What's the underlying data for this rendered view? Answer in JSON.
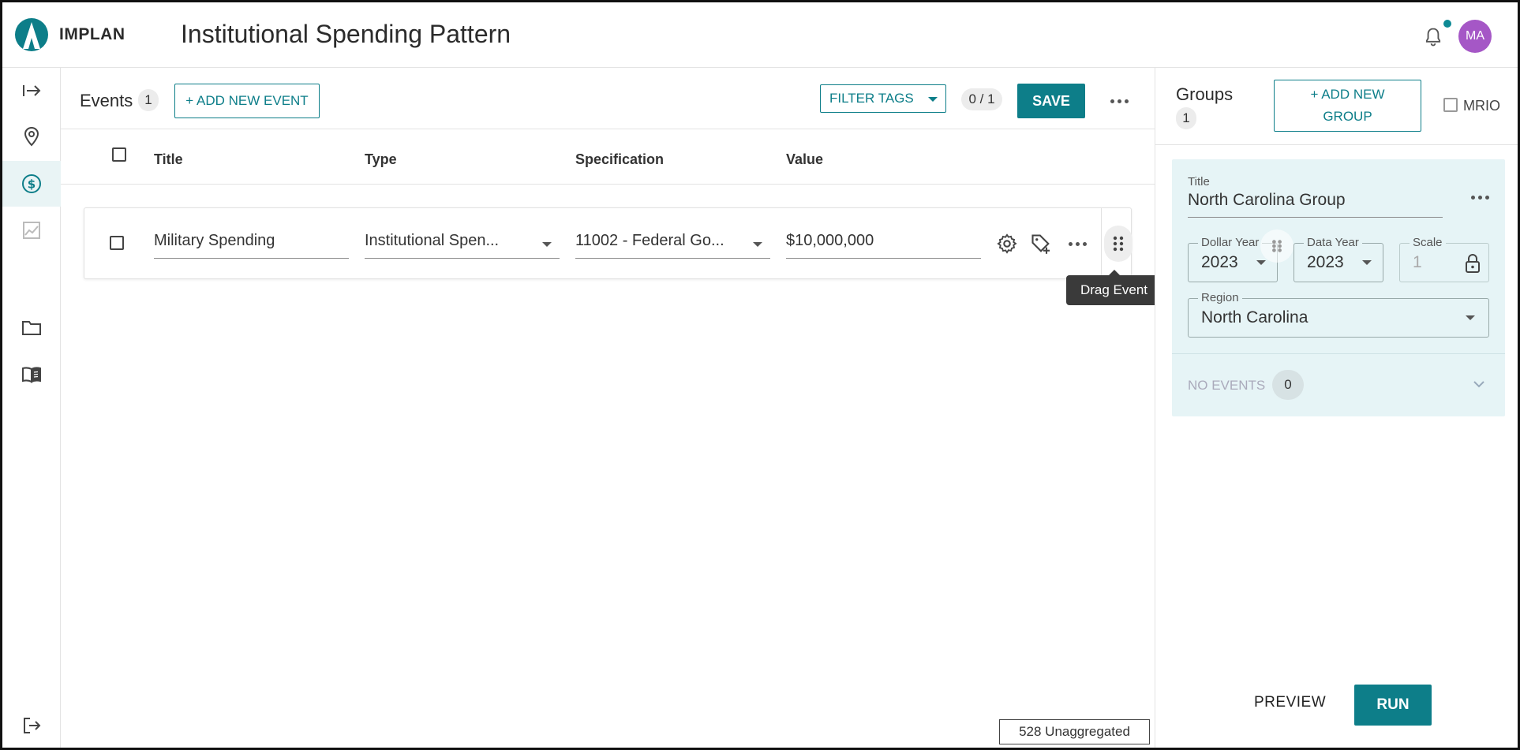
{
  "header": {
    "brand": "IMPLAN",
    "title": "Institutional Spending Pattern",
    "avatar_initials": "MA",
    "notification_dot_color": "#0d8a95",
    "avatar_color": "#a557c6"
  },
  "sidebar": {
    "items": [
      {
        "icon": "expand-arrow-icon"
      },
      {
        "icon": "location-pin-icon"
      },
      {
        "icon": "dollar-circle-icon",
        "active": true
      },
      {
        "icon": "chart-icon"
      },
      {
        "icon": "folder-icon"
      },
      {
        "icon": "book-icon"
      },
      {
        "icon": "logout-icon"
      }
    ]
  },
  "events": {
    "label": "Events",
    "count": "1",
    "add_button": "+ ADD NEW EVENT",
    "filter_tags": "FILTER TAGS",
    "selection_count": "0 / 1",
    "save_label": "SAVE",
    "columns": {
      "title": "Title",
      "type": "Type",
      "specification": "Specification",
      "value": "Value"
    },
    "rows": [
      {
        "title": "Military Spending",
        "type": "Institutional Spen...",
        "specification": "11002 - Federal Go...",
        "value": "$10,000,000"
      }
    ],
    "drag_tooltip": "Drag Event",
    "unaggregated_label": "528 Unaggregated"
  },
  "groups": {
    "label": "Groups",
    "count": "1",
    "add_button": "+ ADD NEW GROUP",
    "mrio_label": "MRIO",
    "card": {
      "title_label": "Title",
      "title_value": "North Carolina Group",
      "dollar_year_label": "Dollar Year",
      "dollar_year_value": "2023",
      "data_year_label": "Data Year",
      "data_year_value": "2023",
      "scale_label": "Scale",
      "scale_value": "1",
      "region_label": "Region",
      "region_value": "North Carolina",
      "no_events_label": "NO EVENTS",
      "no_events_count": "0"
    },
    "preview_label": "PREVIEW",
    "run_label": "RUN"
  },
  "colors": {
    "accent": "#0d7e89",
    "group_card_bg": "#e6f4f6"
  }
}
